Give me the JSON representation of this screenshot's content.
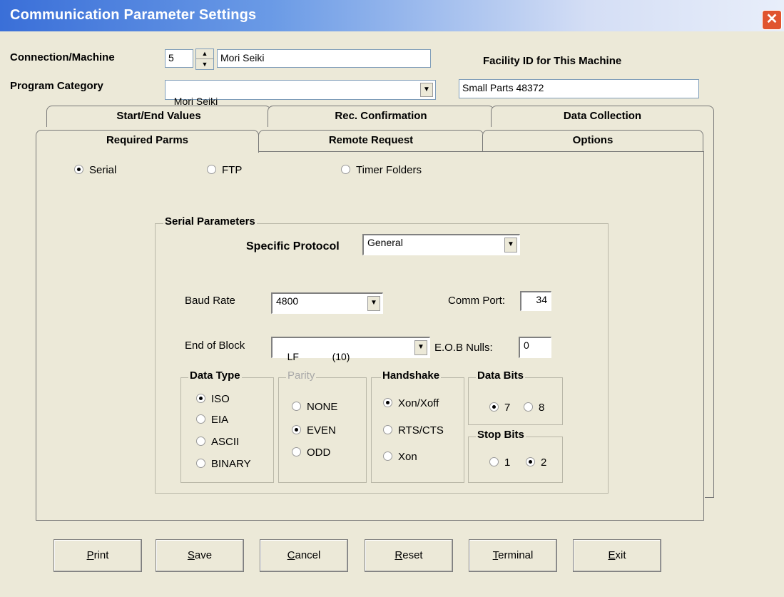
{
  "window": {
    "title": "Communication Parameter Settings",
    "close_glyph": "✕"
  },
  "header": {
    "connection_label": "Connection/Machine",
    "connection_value": "5",
    "machine_name": "Mori Seiki",
    "facility_label": "Facility ID for This Machine",
    "program_category_label": "Program Category",
    "program_category_value": "Mori Seiki",
    "facility_value": "Small Parts 48372"
  },
  "tabs_back": [
    "Start/End Values",
    "Rec. Confirmation",
    "Data Collection"
  ],
  "tabs_front": [
    "Required Parms",
    "Remote Request",
    "Options"
  ],
  "mode": {
    "options": [
      "Serial",
      "FTP",
      "Timer Folders"
    ],
    "selected": "Serial"
  },
  "serial": {
    "group_label": "Serial Parameters",
    "protocol_label": "Specific Protocol",
    "protocol_value": "General",
    "baud_label": "Baud Rate",
    "baud_value": "4800",
    "comm_port_label": "Comm Port:",
    "comm_port_value": "34",
    "eob_label": "End of Block",
    "eob_value": "LF            (10)",
    "eob_nulls_label": "E.O.B Nulls:",
    "eob_nulls_value": "0"
  },
  "data_type": {
    "label": "Data Type",
    "options": [
      "ISO",
      "EIA",
      "ASCII",
      "BINARY"
    ],
    "selected": "ISO"
  },
  "parity": {
    "label": "Parity",
    "options": [
      "NONE",
      "EVEN",
      "ODD"
    ],
    "selected": "EVEN"
  },
  "handshake": {
    "label": "Handshake",
    "options": [
      "Xon/Xoff",
      "RTS/CTS",
      "Xon"
    ],
    "selected": "Xon/Xoff"
  },
  "data_bits": {
    "label": "Data Bits",
    "options": [
      "7",
      "8"
    ],
    "selected": "7"
  },
  "stop_bits": {
    "label": "Stop Bits",
    "options": [
      "1",
      "2"
    ],
    "selected": "2"
  },
  "buttons": {
    "print": {
      "mnemonic": "P",
      "rest": "rint"
    },
    "save": {
      "mnemonic": "S",
      "rest": "ave"
    },
    "cancel": {
      "mnemonic": "C",
      "rest": "ancel"
    },
    "reset": {
      "mnemonic": "R",
      "rest": "eset"
    },
    "terminal": {
      "mnemonic": "T",
      "rest": "erminal"
    },
    "exit": {
      "mnemonic": "E",
      "rest": "xit"
    }
  }
}
